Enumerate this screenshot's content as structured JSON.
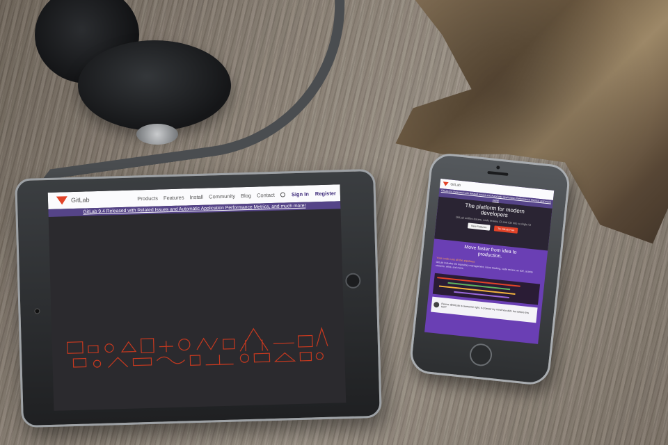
{
  "scene": {
    "description_tags": [
      "wooden-desk",
      "headphones",
      "driftwood",
      "tablet",
      "smartphone"
    ]
  },
  "tablet": {
    "nav": {
      "logo_text": "GitLab",
      "items": [
        "Products",
        "Features",
        "Install",
        "Community",
        "Blog",
        "Contact"
      ],
      "sign_in": "Sign In",
      "register": "Register"
    },
    "banner": "GitLab 9.4 Released with Related Issues and Automatic Application Performance Metrics, and much more!"
  },
  "phone": {
    "nav": {
      "logo_text": "GitLab"
    },
    "hero": {
      "title_line1": "The platform for modern",
      "title_line2": "developers",
      "subtitle": "GitLab unifies issues, code review, CI and CD into a single UI",
      "button_light": "View Features",
      "button_orange": "Try GitLab Free"
    },
    "section": {
      "title_line1": "Move faster from idea to",
      "title_line2": "production.",
      "subtitle": "Your code runs all the pipelines",
      "body": "GitLab includes Git repository management, issue tracking, code review, an IDE, activity streams, wikis, and more."
    },
    "review": {
      "text": "Reena: @GitLab is awesome right, it crossed my mind how did I live before this tool?"
    }
  },
  "colors": {
    "gitlab_orange": "#e24329",
    "gitlab_purple": "#554488",
    "screen_dark": "#2b2a2e"
  }
}
